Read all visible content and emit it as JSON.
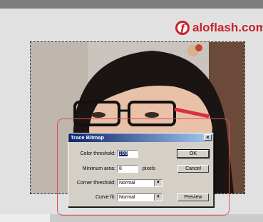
{
  "watermark": {
    "text": "aloflash.com",
    "icon": "flash-logo-icon",
    "color": "#c8232c"
  },
  "dialog": {
    "title": "Trace Bitmap",
    "close": "×",
    "color_threshold": {
      "label": "Color threshold:",
      "value": "100"
    },
    "minimum_area": {
      "label": "Minimum area:",
      "value": "8",
      "unit": "pixels"
    },
    "corner_threshold": {
      "label": "Corner threshold:",
      "value": "Normal"
    },
    "curve_fit": {
      "label": "Curve fit:",
      "value": "Normal"
    },
    "ok_label": "OK",
    "cancel_label": "Cancel",
    "preview_label": "Preview",
    "dropdown_arrow": "▼"
  },
  "colors": {
    "titlebar": "#0a246a",
    "highlight": "#e05050"
  }
}
